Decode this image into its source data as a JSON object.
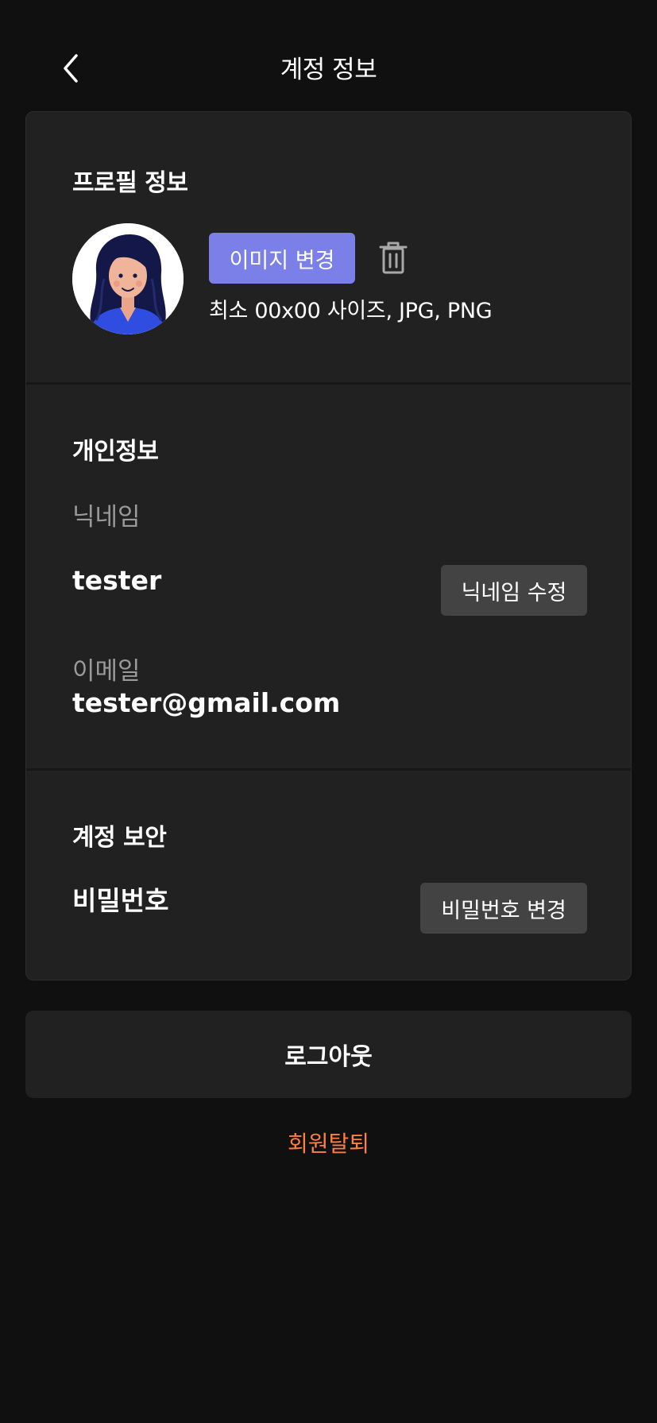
{
  "header": {
    "title": "계정 정보",
    "back_icon": "chevron-left-icon"
  },
  "profile": {
    "title": "프로필 정보",
    "change_image_label": "이미지 변경",
    "delete_icon": "trash-icon",
    "hint": "최소 00x00 사이즈, JPG, PNG"
  },
  "personal": {
    "title": "개인정보",
    "nickname_label": "닉네임",
    "nickname_value": "tester",
    "edit_nickname_label": "닉네임 수정",
    "email_label": "이메일",
    "email_value": "tester@gmail.com"
  },
  "security": {
    "title": "계정 보안",
    "password_label": "비밀번호",
    "change_password_label": "비밀번호 변경"
  },
  "logout_label": "로그아웃",
  "withdraw_label": "회원탈퇴",
  "colors": {
    "background": "#101010",
    "card": "#212121",
    "accent": "#7b7fe8",
    "danger": "#ff7f40",
    "secondary_button": "#434343"
  }
}
